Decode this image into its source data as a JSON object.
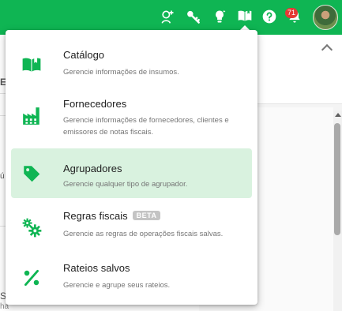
{
  "topbar": {
    "icons": [
      "user-add-icon",
      "key-icon",
      "lightbulb-icon",
      "catalog-book-icon",
      "help-icon",
      "notifications-bell-icon"
    ],
    "notification_count": "71",
    "brand_color": "#0fb553"
  },
  "background": {
    "fragments": [
      "E",
      "ú",
      "S",
      "ha"
    ]
  },
  "menu": {
    "items": [
      {
        "title": "Catálogo",
        "description": "Gerencie informações de insumos.",
        "icon": "open-book-icon"
      },
      {
        "title": "Fornecedores",
        "description": "Gerencie informações de fornecedores, clientes e emissores de notas fiscais.",
        "icon": "factory-icon"
      },
      {
        "title": "Agrupadores",
        "description": "Gerencie qualquer tipo de agrupador.",
        "icon": "tag-icon",
        "selected": true
      },
      {
        "title": "Regras fiscais",
        "badge": "BETA",
        "description": "Gerencie as regras de operações fiscais salvas.",
        "icon": "gears-icon"
      },
      {
        "title": "Rateios salvos",
        "description": "Gerencie e agrupe seus rateios.",
        "icon": "percent-icon"
      }
    ],
    "accent_color": "#0fb553",
    "selected_bg": "#d9f2df"
  }
}
